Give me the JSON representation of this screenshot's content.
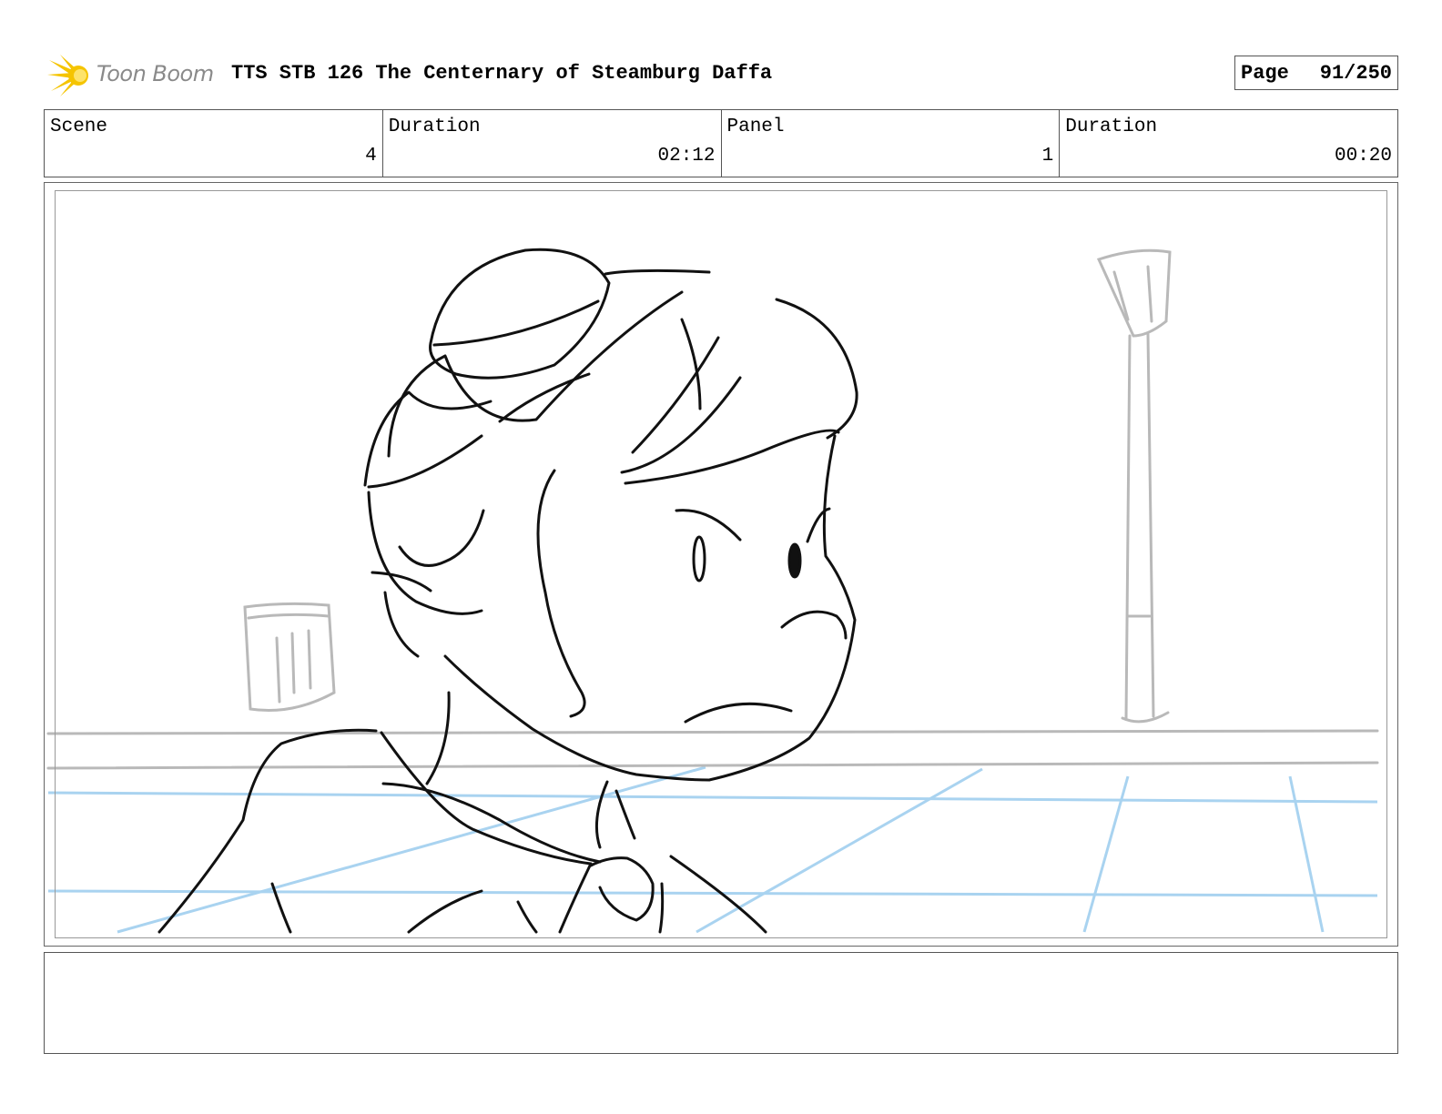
{
  "header": {
    "logo_text": "Toon Boom",
    "title": "TTS STB 126 The Centernary of Steamburg Daffa",
    "page_label": "Page",
    "page_value": "91/250"
  },
  "info": {
    "scene_label": "Scene",
    "scene_value": "4",
    "scene_duration_label": "Duration",
    "scene_duration_value": "02:12",
    "panel_label": "Panel",
    "panel_value": "1",
    "panel_duration_label": "Duration",
    "panel_duration_value": "00:20"
  },
  "notes": {
    "text": ""
  },
  "colors": {
    "logo_accent": "#f5c400",
    "sketch_line": "#111111",
    "background_sketch": "#b9b9b9",
    "guide_line": "#a9d3f0"
  }
}
